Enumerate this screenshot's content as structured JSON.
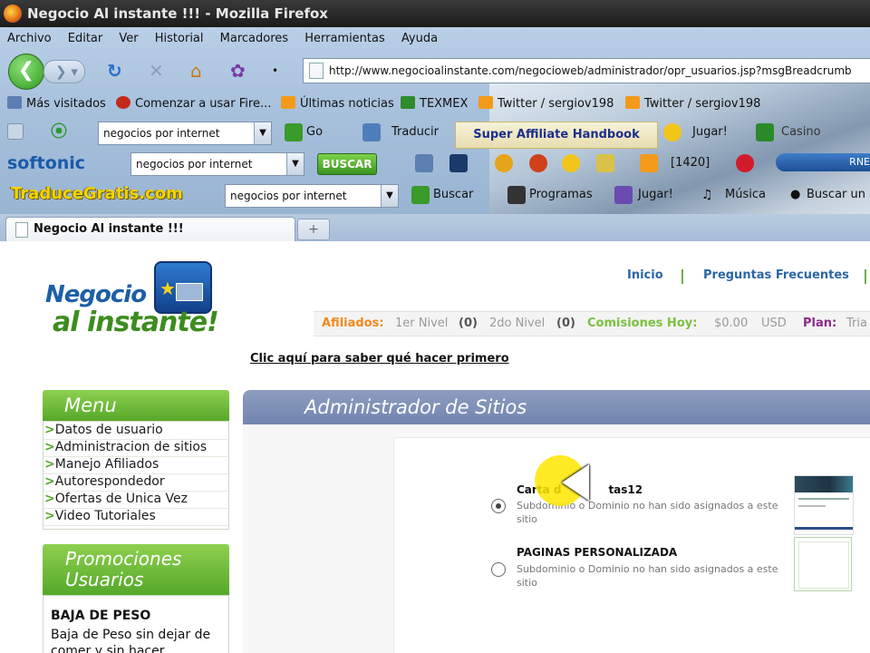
{
  "window": {
    "title": "Negocio Al instante !!! - Mozilla Firefox"
  },
  "menubar": [
    "Archivo",
    "Editar",
    "Ver",
    "Historial",
    "Marcadores",
    "Herramientas",
    "Ayuda"
  ],
  "address": {
    "url": "http://www.negocioalinstante.com/negocioweb/administrador/opr_usuarios.jsp?msgBreadcrumb"
  },
  "bookmarks": [
    "Más visitados",
    "Comenzar a usar Fire...",
    "Últimas noticias",
    "TEXMEX",
    "Twitter / sergiov198",
    "Twitter / sergiov198"
  ],
  "toolbar1": {
    "search_value": "negocios por internet",
    "go_label": "Go",
    "translate_label": "Traducir",
    "affiliate_label": "Super Affiliate Handbook",
    "play_label": "Jugar!",
    "casino_label": "Casino"
  },
  "toolbar2": {
    "brand": "softonic",
    "search_value": "negocios por internet",
    "buscar_label": "BUSCAR",
    "counter": "[1420]",
    "radio_label": "RNE"
  },
  "toolbar3": {
    "brand": "TraduceGratis.com",
    "search_value": "negocios por internet",
    "buscar_label": "Buscar",
    "programas_label": "Programas",
    "jugar_label": "Jugar!",
    "musica_label": "Música",
    "buscar_un_label": "Buscar un"
  },
  "tab": {
    "title": "Negocio Al instante !!!",
    "new_tab": "+"
  },
  "site": {
    "logo_line1": "Negocio",
    "logo_line2": "al instante!",
    "nav": [
      "Inicio",
      "Preguntas Frecuentes"
    ],
    "stats": {
      "afiliados": "Afiliados:",
      "nivel1": "1er Nivel",
      "nivel1_count": "(0)",
      "nivel2": "2do Nivel",
      "nivel2_count": "(0)",
      "comisiones": "Comisiones Hoy:",
      "amount": "$0.00",
      "currency": "USD",
      "plan": "Plan:",
      "plan_value": "Tria"
    },
    "first_link": "Clic aquí para saber qué hacer primero",
    "menu_title": "Menu",
    "menu_items": [
      "Datos de usuario",
      "Administracion de sitios",
      "Manejo Afiliados",
      "Autorespondedor",
      "Ofertas de Unica Vez",
      "Video Tutoriales"
    ],
    "promo_title_1": "Promociones",
    "promo_title_2": "Usuarios",
    "promo_item_title": "BAJA DE PESO",
    "promo_item_text": "Baja de Peso sin dejar de comer y sin hacer",
    "admin_title": "Administrador de Sitios",
    "sites": [
      {
        "name_start": "Carta d",
        "name_end": "tas12",
        "note": "Subdominio o Dominio no han sido asignados a este sitio"
      },
      {
        "name": "PAGINAS PERSONALIZADA",
        "note": "Subdominio o Dominio no han sido asignados a este sitio"
      }
    ]
  },
  "colors": {
    "green": "#55a82a",
    "blue_header": "#7f8fb6",
    "link_blue": "#2a66a8",
    "cursor_highlight": "#ffe600"
  }
}
